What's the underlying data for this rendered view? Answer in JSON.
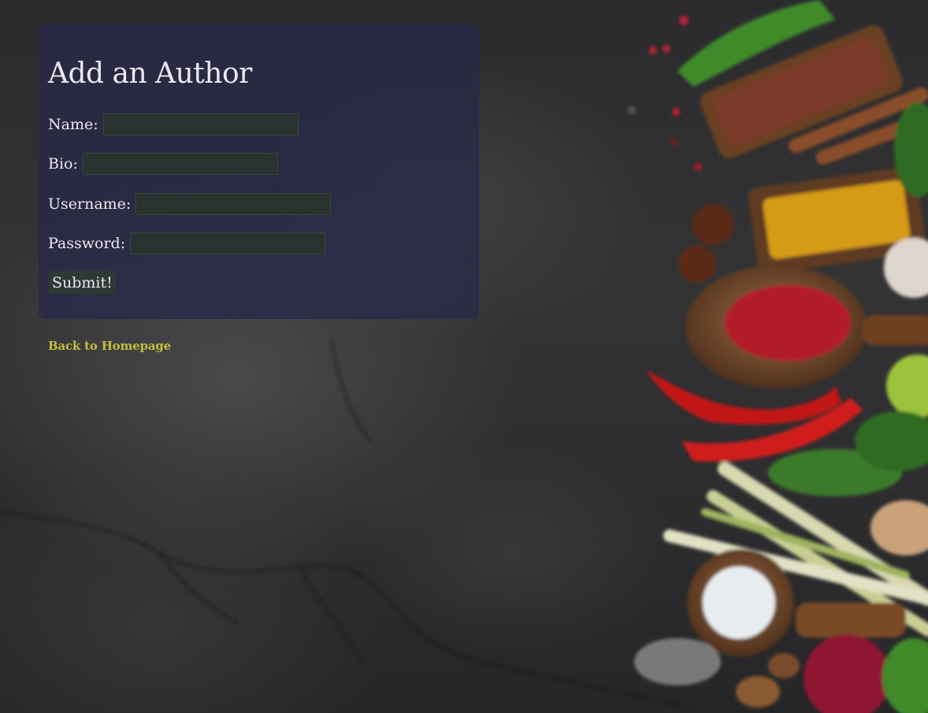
{
  "form": {
    "title": "Add an Author",
    "fields": {
      "name": {
        "label": "Name:",
        "value": ""
      },
      "bio": {
        "label": "Bio:",
        "value": ""
      },
      "username": {
        "label": "Username:",
        "value": ""
      },
      "password": {
        "label": "Password:",
        "value": ""
      }
    },
    "submit_label": "Submit!"
  },
  "nav": {
    "back_link": "Back to Homepage"
  },
  "colors": {
    "panel_bg": "#28284a",
    "field_bg": "#28322e",
    "link": "#c6bf3a"
  }
}
